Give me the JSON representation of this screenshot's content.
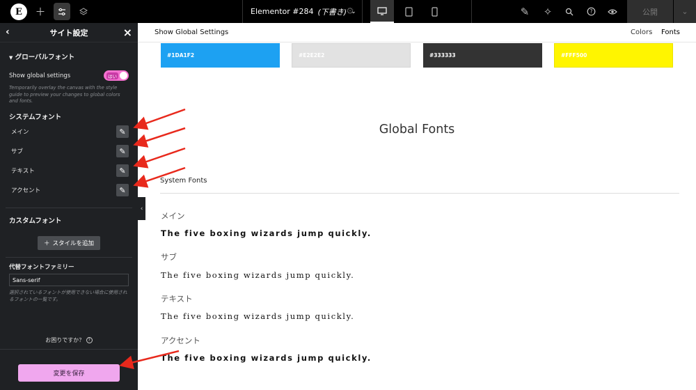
{
  "topbar": {
    "logo_glyph": "E",
    "add_icon": "plus-icon",
    "site_settings_icon": "sliders-icon",
    "structure_icon": "layers-icon",
    "document_title_prefix": "Elementor #284",
    "document_title_status": "(下書き)",
    "devices": [
      "desktop-icon",
      "tablet-icon",
      "mobile-icon"
    ],
    "publish_label": "公開"
  },
  "sidebar": {
    "title": "サイト設定",
    "section_title": "グローバルフォント",
    "show_global_label": "Show global settings",
    "toggle_text": "はい",
    "help_text": "Temporarily overlay the canvas with the style guide to preview your changes to global colors and fonts.",
    "system_fonts_title": "システムフォント",
    "system_fonts": [
      {
        "label": "メイン"
      },
      {
        "label": "サブ"
      },
      {
        "label": "テキスト"
      },
      {
        "label": "アクセント"
      }
    ],
    "custom_fonts_title": "カスタムフォント",
    "add_style_label": "スタイルを追加",
    "fallback_title": "代替フォントファミリー",
    "fallback_value": "Sans-serif",
    "fallback_help": "選択されているフォントが使用できない場合に使用されるフォントの一覧です。",
    "need_help": "お困りですか？",
    "save_label": "変更を保存"
  },
  "canvas": {
    "header_title": "Show Global Settings",
    "tabs": [
      "Colors",
      "Fonts"
    ],
    "active_tab": "Fonts",
    "swatches": [
      {
        "hex": "#1DA1F2",
        "label": "#1DA1F2",
        "text_color": "#ffffff"
      },
      {
        "hex": "#E2E2E2",
        "label": "#E2E2E2",
        "text_color": "#ffffff"
      },
      {
        "hex": "#333333",
        "label": "#333333",
        "text_color": "#ffffff"
      },
      {
        "hex": "#FFF500",
        "label": "#FFF500",
        "text_color": "#ffffff"
      }
    ],
    "global_fonts_title": "Global Fonts",
    "system_fonts_label": "System Fonts",
    "fonts": [
      {
        "name": "メイン",
        "sample": "The five boxing wizards jump quickly."
      },
      {
        "name": "サブ",
        "sample": "The five boxing wizards jump quickly."
      },
      {
        "name": "テキスト",
        "sample": "The five boxing wizards jump quickly."
      },
      {
        "name": "アクセント",
        "sample": "The five boxing wizards jump quickly."
      }
    ]
  },
  "colors": {
    "accent_pink": "#f0a7ee",
    "annotation_red": "#e8291c",
    "sidebar_bg": "#1f2124"
  }
}
